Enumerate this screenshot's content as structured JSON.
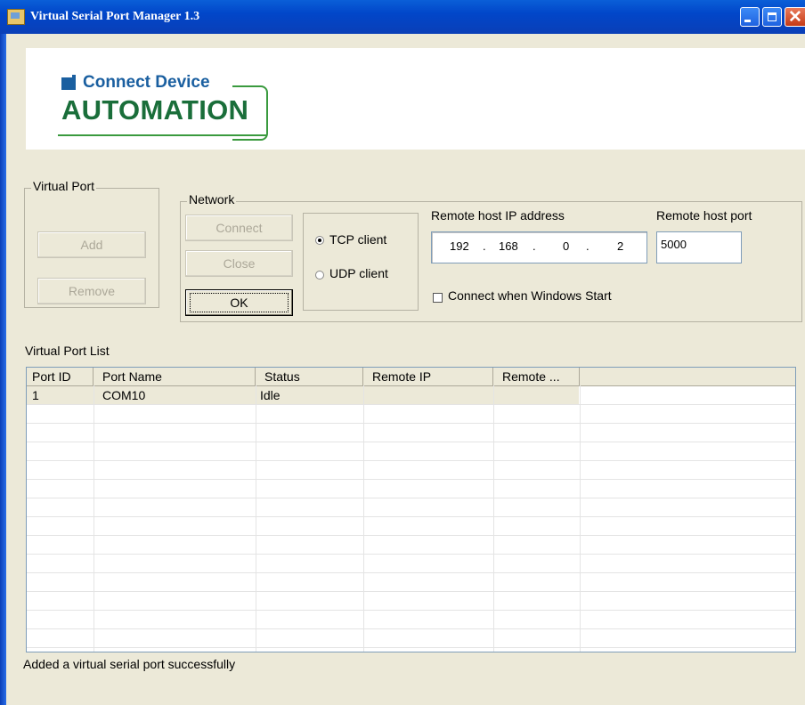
{
  "window": {
    "title": "Virtual Serial Port Manager 1.3"
  },
  "logo": {
    "line1": "Connect Device",
    "line2": "AUTOMATION",
    "colors": {
      "blue": "#1a5fa0",
      "green": "#1a6e3a"
    }
  },
  "virtual_port": {
    "group_title": "Virtual Port",
    "add_label": "Add",
    "remove_label": "Remove"
  },
  "network": {
    "group_title": "Network",
    "connect_label": "Connect",
    "close_label": "Close",
    "ok_label": "OK",
    "tcp_label": "TCP client",
    "udp_label": "UDP client",
    "selected_mode": "TCP client",
    "remote_ip_label": "Remote host IP address",
    "remote_ip": [
      "192",
      "168",
      "0",
      "2"
    ],
    "ip_separator": ".",
    "remote_port_label": "Remote host port",
    "remote_port": "5000",
    "start_label": "Connect when Windows Start",
    "start_checked": false
  },
  "list": {
    "label": "Virtual Port List",
    "columns": [
      "Port ID",
      "Port Name",
      "Status",
      "Remote IP",
      "Remote ..."
    ],
    "rows": [
      [
        "1",
        "COM10",
        "Idle",
        "",
        ""
      ]
    ]
  },
  "status_text": "Added a virtual serial port successfully"
}
